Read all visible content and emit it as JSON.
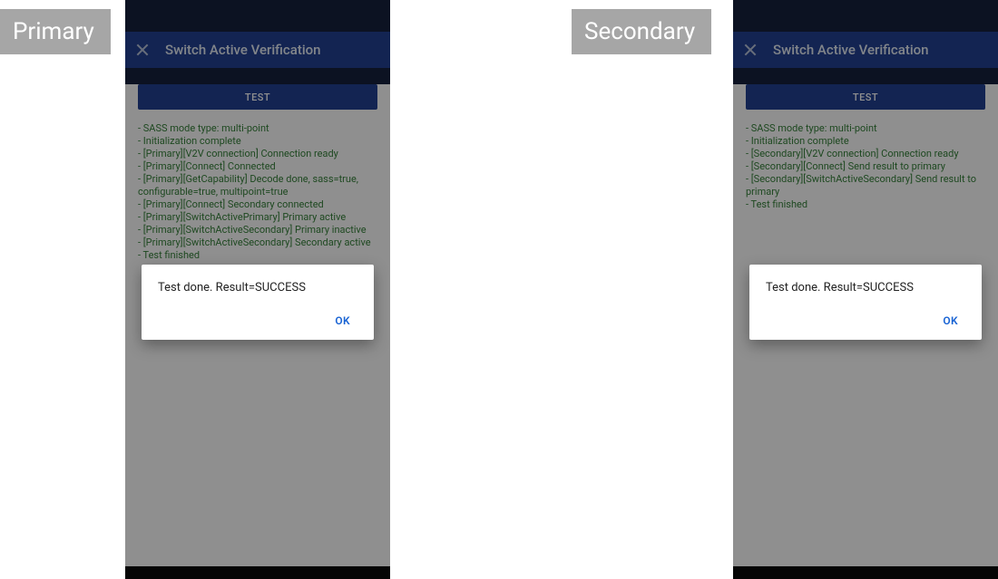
{
  "labels": {
    "primary": "Primary",
    "secondary": "Secondary"
  },
  "primary": {
    "appbar_title": "Switch Active Verification",
    "test_button": "TEST",
    "log": [
      "- SASS mode type: multi-point",
      "- Initialization complete",
      "- [Primary][V2V connection] Connection ready",
      "- [Primary][Connect] Connected",
      "- [Primary][GetCapability] Decode done, sass=true, configurable=true, multipoint=true",
      "- [Primary][Connect] Secondary connected",
      "- [Primary][SwitchActivePrimary] Primary active",
      "- [Primary][SwitchActiveSecondary] Primary inactive",
      "- [Primary][SwitchActiveSecondary] Secondary active",
      "- Test finished"
    ],
    "dialog": {
      "message": "Test done. Result=SUCCESS",
      "ok": "OK"
    }
  },
  "secondary": {
    "appbar_title": "Switch Active Verification",
    "test_button": "TEST",
    "log": [
      "- SASS mode type: multi-point",
      "- Initialization complete",
      "- [Secondary][V2V connection] Connection ready",
      "- [Secondary][Connect] Send result to primary",
      "- [Secondary][SwitchActiveSecondary] Send result to primary",
      "- Test finished"
    ],
    "dialog": {
      "message": "Test done. Result=SUCCESS",
      "ok": "OK"
    }
  }
}
